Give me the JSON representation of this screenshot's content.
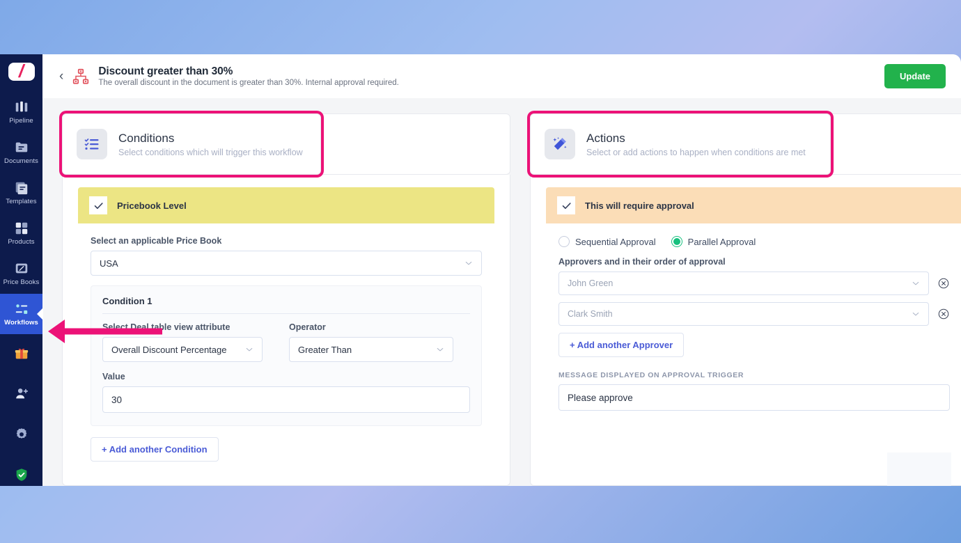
{
  "window": {
    "header": {
      "back_label": "‹",
      "icon": "sitemap-icon",
      "title": "Discount greater than 30%",
      "subtitle": "The overall discount in the document is greater than 30%. Internal approval required.",
      "update_label": "Update",
      "update_color": "#22b24c"
    },
    "sidebar": {
      "logo": "/",
      "items": [
        {
          "label": "Pipeline",
          "icon": "pipeline-icon",
          "active": false
        },
        {
          "label": "Documents",
          "icon": "documents-icon",
          "active": false
        },
        {
          "label": "Templates",
          "icon": "templates-icon",
          "active": false
        },
        {
          "label": "Products",
          "icon": "products-icon",
          "active": false
        },
        {
          "label": "Price Books",
          "icon": "price-books-icon",
          "active": false
        },
        {
          "label": "Workflows",
          "icon": "workflows-icon",
          "active": true
        },
        {
          "label": "",
          "icon": "gift-icon",
          "active": false
        },
        {
          "label": "",
          "icon": "add-user-icon",
          "active": false
        },
        {
          "label": "",
          "icon": "gear-icon",
          "active": false
        },
        {
          "label": "",
          "icon": "shield-check-icon",
          "active": false
        }
      ]
    },
    "conditions_panel": {
      "icon": "checklist-icon",
      "title": "Conditions",
      "subtitle": "Select conditions which will trigger this workflow",
      "banner_label": "Pricebook Level",
      "banner_color": "#ece584",
      "pricebook_label": "Select an applicable Price Book",
      "pricebook_value": "USA",
      "condition_title": "Condition 1",
      "attribute_label": "Select Deal table view attribute",
      "attribute_value": "Overall Discount Percentage",
      "operator_label": "Operator",
      "operator_value": "Greater Than",
      "value_label": "Value",
      "value_value": "30",
      "add_condition_label": "+ Add another Condition"
    },
    "actions_panel": {
      "icon": "magic-wand-icon",
      "title": "Actions",
      "subtitle": "Select or add actions to happen when conditions are met",
      "banner_label": "This will require approval",
      "banner_color": "#fbddb7",
      "radio_sequential": "Sequential Approval",
      "radio_parallel": "Parallel Approval",
      "selected_radio": "Parallel Approval",
      "radio_accent": "#16c07e",
      "approvers_label": "Approvers and in their order of approval",
      "approvers": [
        "John Green",
        "Clark Smith"
      ],
      "add_approver_label": "+ Add another Approver",
      "message_label": "MESSAGE DISPLAYED ON APPROVAL TRIGGER",
      "message_value": "Please approve"
    },
    "annotations": {
      "highlight_color": "#ec1277",
      "arrow": "left-pointing-arrow-to-workflows"
    }
  }
}
